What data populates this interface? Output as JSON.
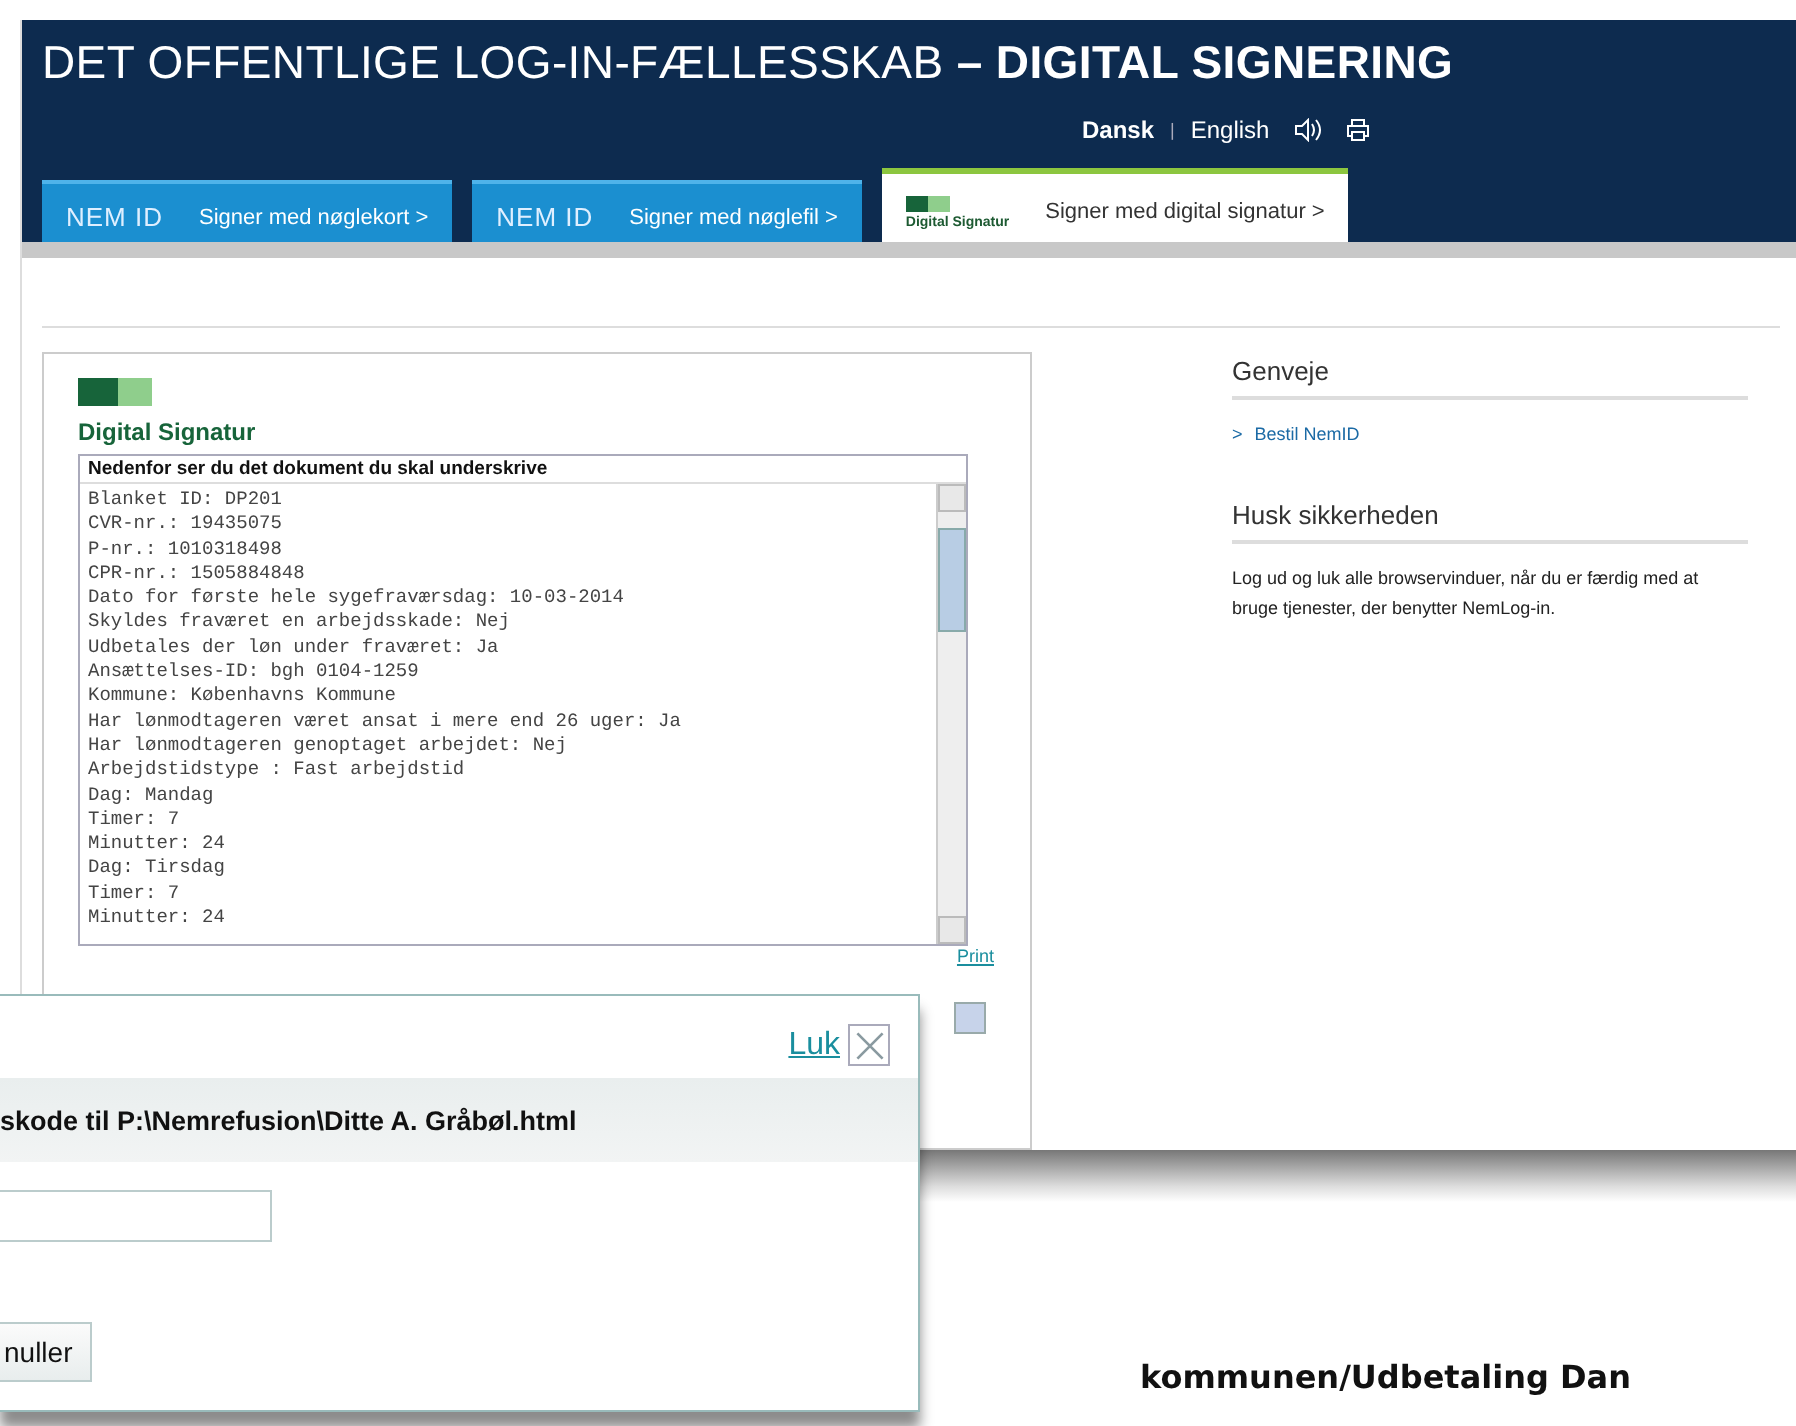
{
  "header": {
    "title": "DET OFFENTLIGE LOG-IN-FÆLLESSKAB **– DIGITAL SIGNERING**",
    "languages": [
      {
        "label": "Dansk",
        "selected": true
      },
      {
        "label": "English",
        "selected": false
      }
    ],
    "separator": "|"
  },
  "tabs": [
    {
      "kind": "nemid",
      "brand": "NEM ID",
      "label": "Signer med nøglekort >",
      "selected": false
    },
    {
      "kind": "nemid",
      "brand": "NEM ID",
      "label": "Signer med nøglefil >",
      "selected": false
    },
    {
      "kind": "digital",
      "brand": "Digital Signatur",
      "label": "Signer med digital signatur >",
      "selected": true
    }
  ],
  "document": {
    "logo_text": "Digital Signatur",
    "caption": "Nedenfor ser du det dokument du skal underskrive",
    "lines": [
      "Blanket ID: DP201",
      "CVR-nr.: 19435075",
      "P-nr.: 1010318498",
      "CPR-nr.: 1505884848",
      "Dato for første hele sygefraværsdag: 10-03-2014",
      "Skyldes fraværet en arbejdsskade: Nej",
      "Udbetales der løn under fraværet: Ja",
      "Ansættelses-ID: bgh 0104-1259",
      "Kommune: Københavns Kommune",
      "Har lønmodtageren været ansat i mere end 26 uger: Ja",
      "Har lønmodtageren genoptaget arbejdet: Nej",
      "Arbejdstidstype : Fast arbejdstid",
      "Dag: Mandag",
      "Timer: 7",
      "Minutter: 24",
      "Dag: Tirsdag",
      "Timer: 7",
      "Minutter: 24"
    ],
    "print_link": "Print"
  },
  "sidebar": [
    {
      "kind": "links",
      "heading": "Genveje",
      "links": [
        {
          "marker": ">",
          "label": "Bestil NemID"
        }
      ]
    },
    {
      "kind": "text",
      "heading": "Husk sikkerheden",
      "text": "Log ud og luk alle browservinduer, når du er færdig med at bruge tjenester, der benytter NemLog-in."
    }
  ],
  "dialog": {
    "close_label": "Luk",
    "heading": "skode til P:\\Nemrefusion\\Ditte A. Gråbøl.html",
    "button": "nuller"
  },
  "caption": "kommunen/Udbetaling Dan"
}
